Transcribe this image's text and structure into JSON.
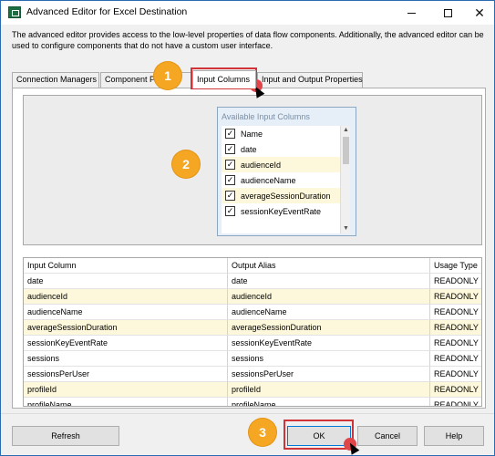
{
  "window": {
    "title": "Advanced Editor for Excel Destination",
    "controls": {
      "minimize_icon": "minimize-icon",
      "maximize_icon": "maximize-icon",
      "close_icon": "close-icon"
    }
  },
  "description": "The advanced editor provides access to the low-level properties of data flow components. Additionally, the advanced editor can be used to configure components that do not have a custom user interface.",
  "tabs": [
    {
      "label": "Connection Managers",
      "active": false
    },
    {
      "label": "Component P",
      "active": false
    },
    {
      "label": "Input Columns",
      "active": true
    },
    {
      "label": "Input and Output Properties",
      "active": false
    }
  ],
  "available_columns": {
    "title": "Available Input Columns",
    "items": [
      {
        "label": "Name",
        "checked": true
      },
      {
        "label": "date",
        "checked": true
      },
      {
        "label": "audienceId",
        "checked": true
      },
      {
        "label": "audienceName",
        "checked": true
      },
      {
        "label": "averageSessionDuration",
        "checked": true
      },
      {
        "label": "sessionKeyEventRate",
        "checked": true
      }
    ]
  },
  "grid": {
    "headers": [
      "Input Column",
      "Output Alias",
      "Usage Type"
    ],
    "rows": [
      [
        "date",
        "date",
        "READONLY"
      ],
      [
        "audienceId",
        "audienceId",
        "READONLY"
      ],
      [
        "audienceName",
        "audienceName",
        "READONLY"
      ],
      [
        "averageSessionDuration",
        "averageSessionDuration",
        "READONLY"
      ],
      [
        "sessionKeyEventRate",
        "sessionKeyEventRate",
        "READONLY"
      ],
      [
        "sessions",
        "sessions",
        "READONLY"
      ],
      [
        "sessionsPerUser",
        "sessionsPerUser",
        "READONLY"
      ],
      [
        "profileId",
        "profileId",
        "READONLY"
      ],
      [
        "profileName",
        "profileName",
        "READONLY"
      ]
    ]
  },
  "buttons": {
    "refresh": "Refresh",
    "ok": "OK",
    "cancel": "Cancel",
    "help": "Help"
  },
  "annotations": {
    "step1": "1",
    "step2": "2",
    "step3": "3",
    "accent": "#f5a623",
    "highlight": "#d13438"
  }
}
